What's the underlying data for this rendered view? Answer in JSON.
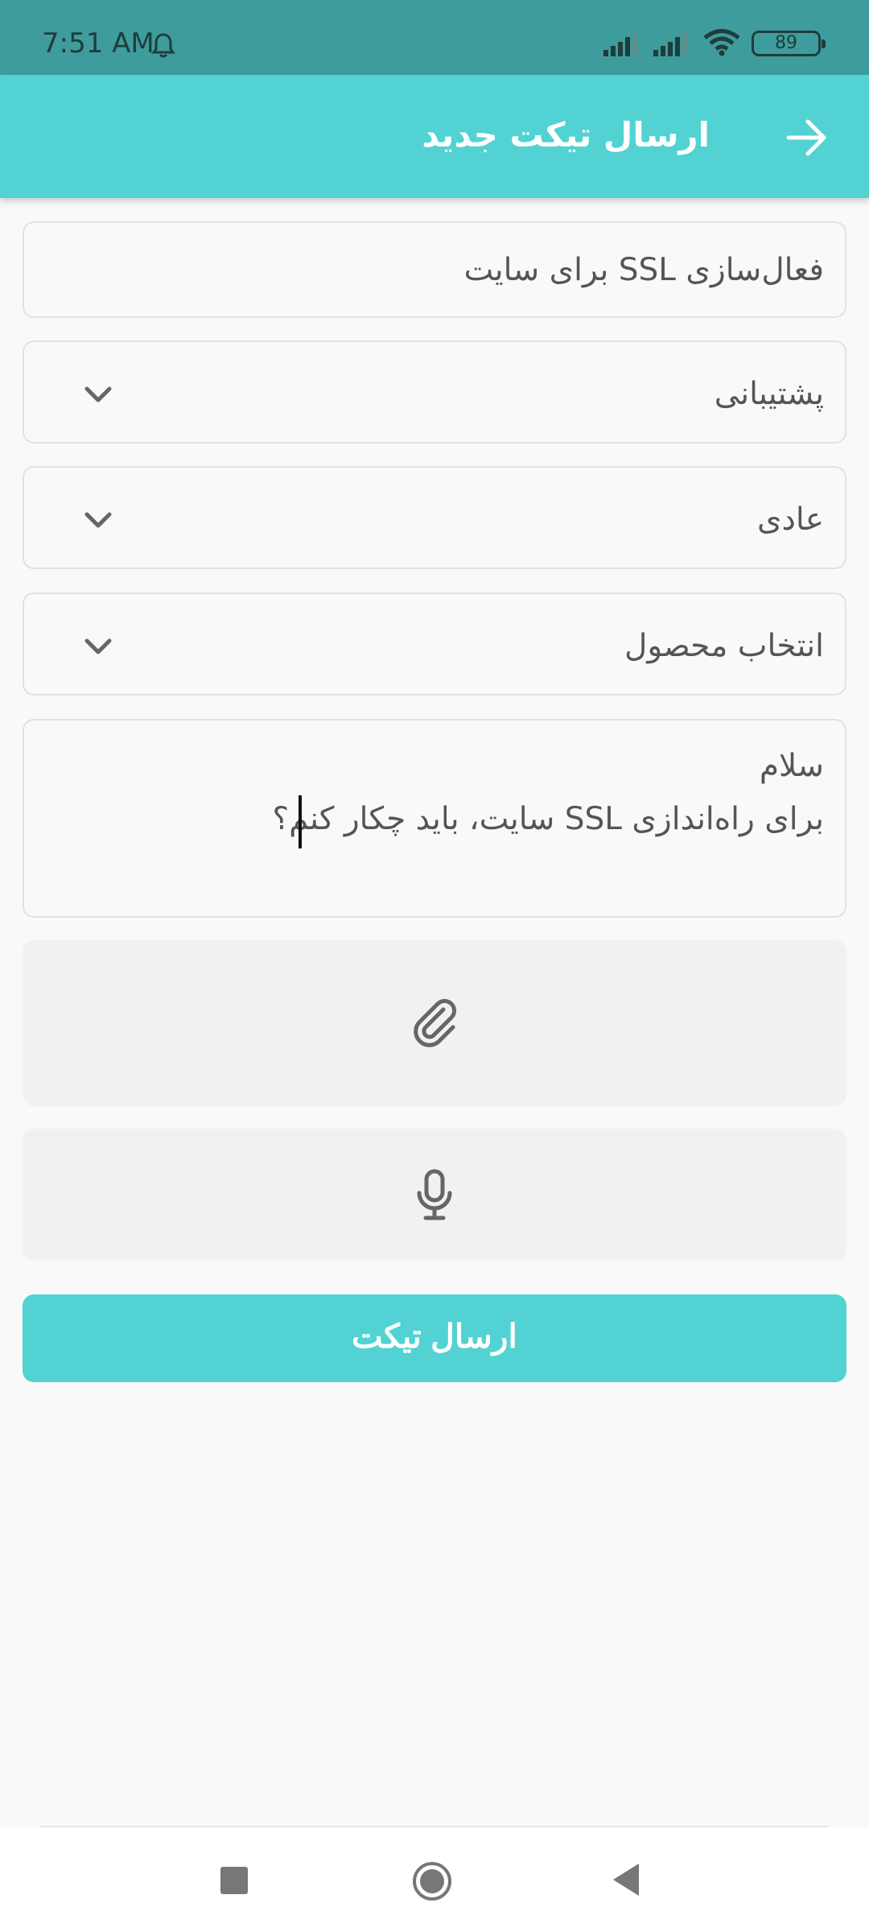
{
  "status_bar": {
    "time": "7:51 AM",
    "battery": "89"
  },
  "app_bar": {
    "title": "ارسال تیکت جدید"
  },
  "form": {
    "subject_value": "فعال‌سازی SSL برای سایت",
    "department_value": "پشتیبانی",
    "priority_value": "عادی",
    "product_value": "انتخاب محصول",
    "message_lines": [
      "سلام",
      "برای راه‌اندازی SSL سایت، باید چکار کنم؟"
    ]
  },
  "submit": {
    "label": "ارسال تیکت"
  },
  "colors": {
    "accent": "#52d2d3",
    "status_bar": "#3f9c9c",
    "icon_gray": "#666666"
  }
}
